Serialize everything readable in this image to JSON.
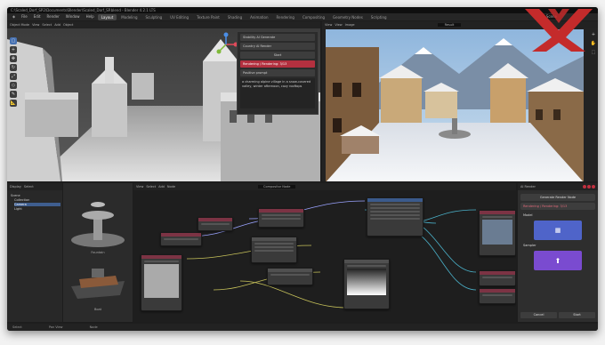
{
  "title_bar": "C:\\Scaled_Dorf_SP2\\Documents\\Blender\\Scaled_Dorf_SP.blend - Blender 4.2.1 LTS",
  "menu": [
    "File",
    "Edit",
    "Render",
    "Window",
    "Help"
  ],
  "workspace_tabs": [
    {
      "label": "Layout",
      "active": true
    },
    {
      "label": "Modeling",
      "active": false
    },
    {
      "label": "Sculpting",
      "active": false
    },
    {
      "label": "UV Editing",
      "active": false
    },
    {
      "label": "Texture Paint",
      "active": false
    },
    {
      "label": "Shading",
      "active": false
    },
    {
      "label": "Animation",
      "active": false
    },
    {
      "label": "Rendering",
      "active": false
    },
    {
      "label": "Compositing",
      "active": false
    },
    {
      "label": "Geometry Nodes",
      "active": false
    },
    {
      "label": "Scripting",
      "active": false
    }
  ],
  "scene_name": "Scene",
  "viewport": {
    "header": [
      "Object Mode",
      "View",
      "Select",
      "Add",
      "Object"
    ],
    "gizmo_axes": {
      "x": "#e04a5a",
      "y": "#7fba3a",
      "z": "#4b8ee6"
    }
  },
  "sidebar": {
    "title": "Stability AI Generate",
    "item1": "Country AI Render",
    "item2": "Start",
    "status": "Rendering / Rendering: 3/13",
    "prompt_label": "Positive prompt",
    "prompt_text": "a charming alpine village in a snow-covered valley, winter afternoon, cozy rooftops"
  },
  "render_view": {
    "header": [
      "View",
      "View",
      "Image"
    ],
    "image_name": "Result"
  },
  "node_editor": {
    "header": [
      "View",
      "Select",
      "Add",
      "Node"
    ],
    "material": "Compositor Node"
  },
  "outliner": {
    "header": [
      "Display",
      "Select",
      "Scene"
    ],
    "items": [
      "Scene",
      "Collection",
      "Camera",
      "Light"
    ]
  },
  "assets": [
    "Fountain",
    "Boat"
  ],
  "right_panel": {
    "title": "AI Render",
    "button1": "Generate Render Node",
    "status": "Rendering / Rendering: 3/13",
    "model_label": "Model",
    "sampler_label": "Sampler",
    "cancel": "Cancel",
    "start": "Start"
  },
  "status_bar": [
    "Select",
    "Pan View",
    "Node"
  ],
  "watermark_color": "#c42b2b"
}
